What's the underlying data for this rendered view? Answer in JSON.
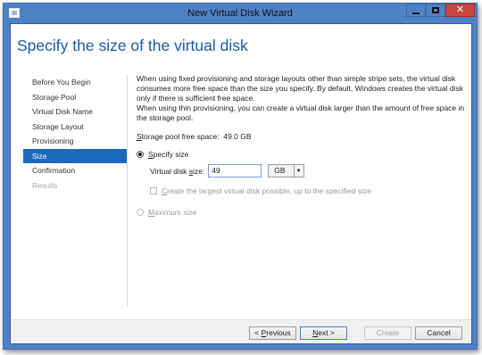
{
  "window": {
    "title": "New Virtual Disk Wizard"
  },
  "titlebar_buttons": {
    "close_glyph": "✕"
  },
  "page": {
    "heading": "Specify the size of the virtual disk"
  },
  "nav": {
    "items": [
      {
        "label": "Before You Begin",
        "state": "normal"
      },
      {
        "label": "Storage Pool",
        "state": "normal"
      },
      {
        "label": "Virtual Disk Name",
        "state": "normal"
      },
      {
        "label": "Storage Layout",
        "state": "normal"
      },
      {
        "label": "Provisioning",
        "state": "normal"
      },
      {
        "label": "Size",
        "state": "active"
      },
      {
        "label": "Confirmation",
        "state": "normal"
      },
      {
        "label": "Results",
        "state": "disabled"
      }
    ]
  },
  "content": {
    "description_lines": [
      "When using fixed provisioning and storage layouts other than simple stripe sets, the virtual disk",
      "consumes more free space than the size you specify. By default, Windows creates the virtual disk",
      "only if there is sufficient free space.",
      "When using thin provisioning, you can create a virtual disk larger than the amount of free space in",
      "the storage pool."
    ],
    "free_space": {
      "label_prefix": "S",
      "label_rest": "torage pool free space:",
      "value": "49.0 GB"
    },
    "specify_size": {
      "label_prefix": "S",
      "label_rest": "pecify size",
      "selected": true
    },
    "virtual_disk_size": {
      "label_start": "Virtual disk ",
      "label_underlined": "s",
      "label_end": "ize:",
      "value": "49",
      "unit": "GB"
    },
    "largest_possible": {
      "label_prefix": "C",
      "label_rest": "reate the largest virtual disk possible, up to the specified size",
      "checked": false,
      "enabled": false
    },
    "maximum_size": {
      "label_prefix": "M",
      "label_rest": "aximum size",
      "selected": false,
      "enabled": false
    }
  },
  "footer": {
    "previous_label": "< Previous",
    "previous_prefix": "< ",
    "previous_underlined": "P",
    "previous_rest": "revious",
    "next_underlined": "N",
    "next_rest": "ext >",
    "create_label": "Create",
    "cancel_label": "Cancel"
  },
  "colors": {
    "title_bar": "#4f81c7",
    "accent_heading": "#1a5aa8",
    "nav_active": "#1b6ac0",
    "close_button": "#c7463f"
  }
}
